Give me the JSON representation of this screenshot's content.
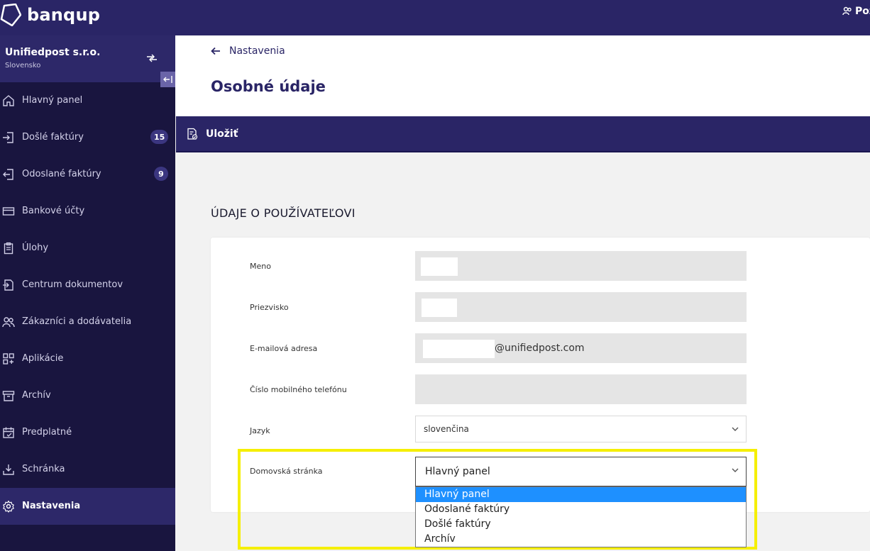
{
  "app": {
    "logo_text": "banqup",
    "user_label": "Poz"
  },
  "company": {
    "name": "Unifiedpost s.r.o.",
    "country": "Slovensko"
  },
  "sidebar": {
    "items": [
      {
        "label": "Hlavný panel",
        "icon": "home-icon"
      },
      {
        "label": "Došlé faktúry",
        "icon": "inbox-arrow-icon",
        "badge": "15"
      },
      {
        "label": "Odoslané faktúry",
        "icon": "outbox-arrow-icon",
        "badge": "9"
      },
      {
        "label": "Bankové účty",
        "icon": "card-icon"
      },
      {
        "label": "Úlohy",
        "icon": "clipboard-icon"
      },
      {
        "label": "Centrum dokumentov",
        "icon": "document-transfer-icon"
      },
      {
        "label": "Zákazníci a dodávatelia",
        "icon": "users-icon"
      },
      {
        "label": "Aplikácie",
        "icon": "apps-icon"
      },
      {
        "label": "Archív",
        "icon": "archive-icon"
      },
      {
        "label": "Predplatné",
        "icon": "calendar-icon"
      },
      {
        "label": "Schránka",
        "icon": "download-tray-icon"
      },
      {
        "label": "Nastavenia",
        "icon": "gear-icon",
        "active": true
      }
    ]
  },
  "header": {
    "back_label": "Nastavenia",
    "title": "Osobné údaje"
  },
  "toolbar": {
    "save_label": "Uložiť"
  },
  "form": {
    "section_title": "ÚDAJE O POUŽÍVATEĽOVI",
    "first_name_label": "Meno",
    "last_name_label": "Priezvisko",
    "email_label": "E-mailová adresa",
    "email_domain": "@unifiedpost.com",
    "phone_label": "Číslo mobilného telefónu",
    "language_label": "Jazyk",
    "language_value": "slovenčina",
    "homepage_label": "Domovská stránka",
    "homepage_value": "Hlavný panel",
    "homepage_options": [
      "Hlavný panel",
      "Odoslané faktúry",
      "Došlé faktúry",
      "Archív"
    ]
  },
  "colors": {
    "brand": "#2a2566",
    "sidebar": "#19153f",
    "highlight": "#f5ef00",
    "option_selected": "#1e90ff"
  }
}
